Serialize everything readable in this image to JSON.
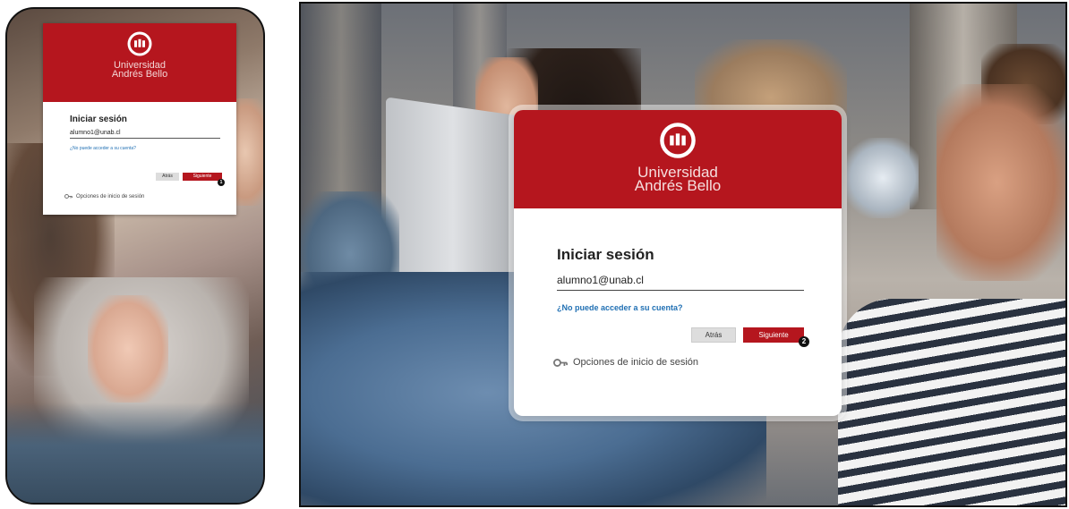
{
  "brand": {
    "line1": "Universidad",
    "line2": "Andrés Bello",
    "color": "#b5161e"
  },
  "small_card": {
    "title": "Iniciar sesión",
    "email_value": "alumno1@unab.cl",
    "link": "¿No puede acceder a su cuenta?",
    "back_label": "Atrás",
    "next_label": "Siguiente",
    "step": "1",
    "options_label": "Opciones de inicio de sesión"
  },
  "large_card": {
    "title": "Iniciar sesión",
    "email_value": "alumno1@unab.cl",
    "link": "¿No puede acceder a su cuenta?",
    "back_label": "Atrás",
    "next_label": "Siguiente",
    "step": "2",
    "options_label": "Opciones de inicio de sesión"
  },
  "icons": {
    "logo": "university-seal-icon",
    "key": "key-icon"
  }
}
